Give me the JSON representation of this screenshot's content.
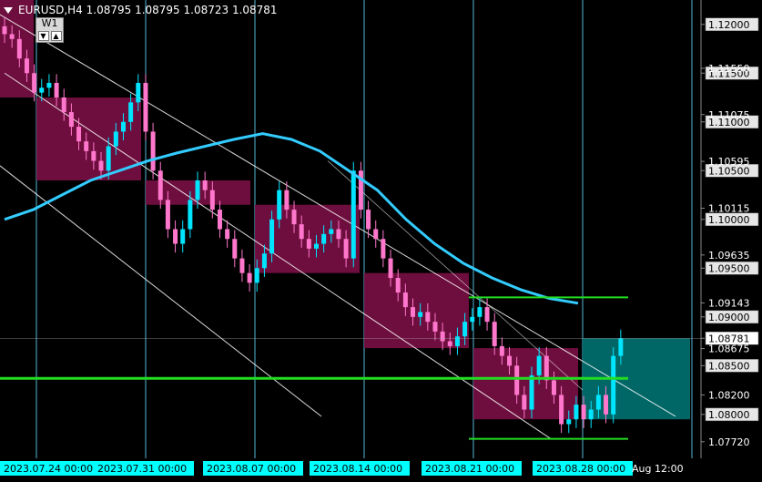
{
  "header": {
    "symbol_line": "EURUSD,H4  1.08795 1.08795 1.08723 1.08781"
  },
  "timeframe_badge": {
    "label": "W1",
    "down_arrow": "▼",
    "up_arrow": "▲"
  },
  "colors": {
    "background": "#000000",
    "grid_vertical": "#66d9ff",
    "candle": "#00e5ff",
    "ma_line": "#33ccff",
    "box_magenta": "#7a0f45",
    "box_teal": "#006b6b",
    "level_green": "#22dd22",
    "axis_label_bg": "#e6e6e6",
    "current_price_bg": "#ffffff"
  },
  "price_axis": {
    "labels": [
      "1.12000",
      "1.11500",
      "1.11000",
      "1.10500",
      "1.10000",
      "1.09500",
      "1.09000",
      "1.08500",
      "1.08000"
    ],
    "extra_labels": [
      "1.11550",
      "1.11075",
      "1.10595",
      "1.10115",
      "1.09635",
      "1.09143",
      "1.08675",
      "1.08200",
      "1.07720"
    ],
    "current_price": "1.08781"
  },
  "time_axis": {
    "labels": [
      "2023.07.24 00:00",
      "2023.07.31 00:00",
      "2023.08.07 00:00",
      "2023.08.14 00:00",
      "2023.08.21 00:00",
      "2023.08.28 00:00",
      "Aug 12:00"
    ]
  },
  "chart_data": {
    "type": "candlestick",
    "symbol": "EURUSD",
    "timeframe": "H4",
    "ohlc_last": {
      "open": 1.08795,
      "high": 1.08795,
      "low": 1.08723,
      "close": 1.08781
    },
    "ylim": [
      1.0755,
      1.1225
    ],
    "close_series": [
      1.119,
      1.1185,
      1.1165,
      1.115,
      1.113,
      1.1135,
      1.114,
      1.1125,
      1.111,
      1.1095,
      1.108,
      1.107,
      1.106,
      1.105,
      1.1075,
      1.109,
      1.11,
      1.112,
      1.114,
      1.109,
      1.105,
      1.102,
      1.099,
      1.0975,
      1.099,
      1.102,
      1.104,
      1.103,
      1.101,
      1.099,
      1.098,
      1.096,
      1.0945,
      1.0935,
      1.095,
      1.0965,
      1.1,
      1.103,
      1.101,
      1.0995,
      1.098,
      1.097,
      1.0975,
      1.0985,
      1.099,
      1.098,
      1.096,
      1.105,
      1.101,
      1.099,
      1.098,
      1.096,
      1.094,
      1.0925,
      1.091,
      1.09,
      1.0905,
      1.0895,
      1.0885,
      1.0875,
      1.087,
      1.088,
      1.0895,
      1.09,
      1.091,
      1.0895,
      1.087,
      1.086,
      1.085,
      1.082,
      1.0805,
      1.084,
      1.086,
      1.0835,
      1.082,
      1.079,
      1.0795,
      1.081,
      1.0795,
      1.0805,
      1.082,
      1.08,
      1.086,
      1.0878
    ],
    "moving_average": [
      1.1,
      1.101,
      1.1025,
      1.104,
      1.105,
      1.106,
      1.1068,
      1.1075,
      1.1082,
      1.1088,
      1.1082,
      1.107,
      1.105,
      1.103,
      1.1,
      1.0975,
      1.0955,
      1.094,
      1.0928,
      1.0919,
      1.0914
    ],
    "levels": [
      {
        "name": "level-1.08370",
        "price": 1.0837
      },
      {
        "name": "level-1.09200",
        "price": 1.092
      },
      {
        "name": "level-1.07750",
        "price": 1.0775
      }
    ]
  }
}
